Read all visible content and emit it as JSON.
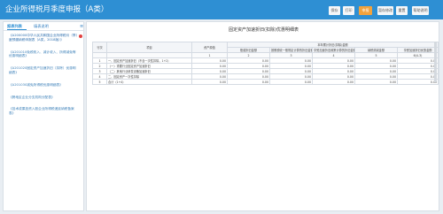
{
  "header": {
    "title": "企业所得税月季度申报（A类）",
    "buttons": [
      "保存",
      "打印",
      "申报",
      "暂存修改",
      "重置",
      "帮助说明"
    ],
    "active_button": "申报",
    "accent": "#2e8fd3",
    "active_color": "#f2a23c"
  },
  "left": {
    "tabs": [
      "报表列表",
      "填表说明"
    ],
    "menu_icon": "menu-icon",
    "items": [
      "《A200000中华人民共和国企业所得税月（季）度预缴纳税申报表（A类，2018版）》",
      "《A201010免税收入、减计收入、所得减免等优惠明细表》",
      "《A201020固定资产加速折旧（扣除）优惠明细表》",
      "《A201030减免所得税优惠明细表》",
      "《跨地区企业分支机构分配表》",
      "《技术成果投资入股企业所得税递延纳税备案表》"
    ]
  },
  "main": {
    "title": "固定资产加速折旧(扣除)优惠明细表",
    "headers": {
      "row": "行次",
      "item": "项目",
      "asset": "资产原值",
      "group": "本年累计折旧(扣除)金额",
      "cols": [
        "账载折旧金额",
        "按照税收一般规定计算的折旧金额",
        "享受加速折旧政策计算的折旧金额",
        "纳税调减金额",
        "享受加速折旧优惠金额"
      ]
    },
    "col_numbers": [
      "1",
      "2",
      "3",
      "4",
      "5",
      "6(4-3)"
    ],
    "rows": [
      {
        "row": "1",
        "item": "一、固定资产加速折旧（不含一次性扣除，1+2）",
        "values": [
          "0.00",
          "0.00",
          "0.00",
          "0.00",
          "0.00",
          "0.00"
        ]
      },
      {
        "row": "2",
        "item": "（一）重要行业固定资产加速折旧",
        "values": [
          "0.00",
          "0.00",
          "0.00",
          "0.00",
          "0.00",
          "0.00"
        ]
      },
      {
        "row": "3",
        "item": "（二）其他行业研发设备加速折旧",
        "values": [
          "0.00",
          "0.00",
          "0.00",
          "0.00",
          "0.00",
          "0.00"
        ]
      },
      {
        "row": "4",
        "item": "二、固定资产一次性扣除",
        "values": [
          "0.00",
          "0.00",
          "0.00",
          "0.00",
          "0.00",
          "0.00"
        ]
      },
      {
        "row": "5",
        "item": "合计（1+4）",
        "values": [
          "0.00",
          "0.00",
          "0.00",
          "0.00",
          "0.00",
          "0.00"
        ]
      }
    ]
  }
}
